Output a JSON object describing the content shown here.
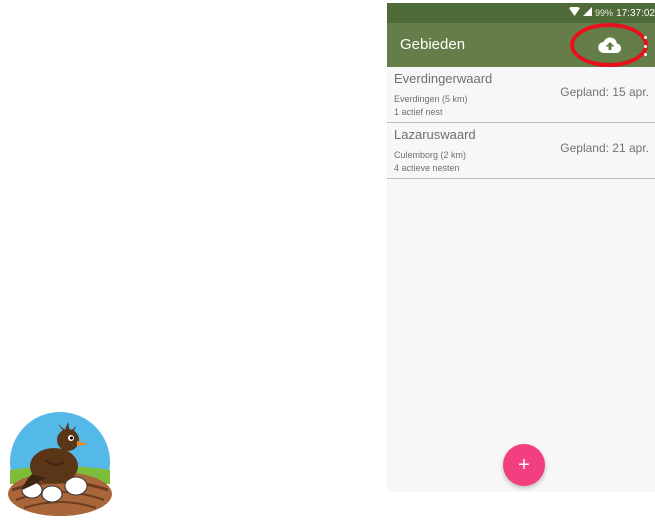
{
  "status_bar": {
    "battery": "99%",
    "time": "17:37:02"
  },
  "app_bar": {
    "title": "Gebieden",
    "upload_icon": "cloud-upload-icon",
    "menu_icon": "more-vert-icon"
  },
  "areas": [
    {
      "name": "Everdingerwaard",
      "location": "Everdingen (5 km)",
      "nests": "1 actief nest",
      "planned": "Gepland: 15 apr."
    },
    {
      "name": "Lazaruswaard",
      "location": "Culemborg (2 km)",
      "nests": "4 actieve nesten",
      "planned": "Gepland: 21 apr."
    }
  ],
  "fab": {
    "label": "+"
  },
  "colors": {
    "status_bar": "#4f6b38",
    "app_bar": "#647d49",
    "fab": "#f23f7f",
    "highlight": "#e8101a"
  }
}
